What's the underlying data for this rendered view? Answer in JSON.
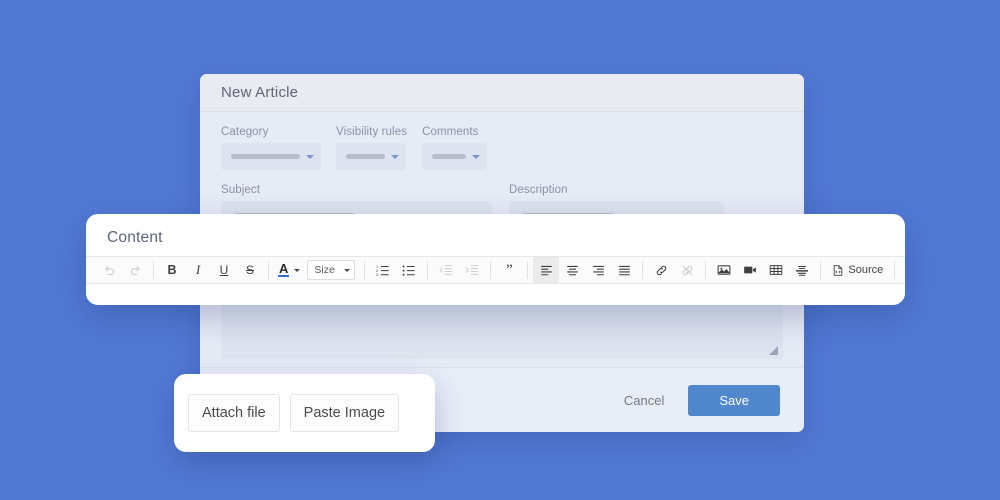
{
  "background_color": "#5179d4",
  "form": {
    "title": "New Article",
    "fields": {
      "category_label": "Category",
      "visibility_label": "Visibility rules",
      "comments_label": "Comments",
      "subject_label": "Subject",
      "description_label": "Description"
    },
    "footer": {
      "cancel_label": "Cancel",
      "save_label": "Save",
      "save_color": "#5087cd"
    }
  },
  "editor": {
    "title": "Content",
    "toolbar": {
      "size_label": "Size",
      "source_label": "Source",
      "color_letter": "A",
      "color_accent": "#2f6fc4",
      "items": [
        {
          "name": "undo-icon",
          "title": "Undo",
          "state": "disabled"
        },
        {
          "name": "redo-icon",
          "title": "Redo",
          "state": "disabled"
        },
        {
          "name": "bold-icon",
          "title": "Bold",
          "state": "normal"
        },
        {
          "name": "italic-icon",
          "title": "Italic",
          "state": "normal"
        },
        {
          "name": "underline-icon",
          "title": "Underline",
          "state": "normal"
        },
        {
          "name": "strikethrough-icon",
          "title": "Strikethrough",
          "state": "normal"
        },
        {
          "name": "text-color-icon",
          "title": "Text Color",
          "state": "normal"
        },
        {
          "name": "font-size-dropdown",
          "title": "Size",
          "state": "normal"
        },
        {
          "name": "numbered-list-icon",
          "title": "Insert/Remove Numbered List",
          "state": "normal"
        },
        {
          "name": "bulleted-list-icon",
          "title": "Insert/Remove Bulleted List",
          "state": "normal"
        },
        {
          "name": "outdent-icon",
          "title": "Decrease Indent",
          "state": "disabled"
        },
        {
          "name": "indent-icon",
          "title": "Increase Indent",
          "state": "disabled"
        },
        {
          "name": "blockquote-icon",
          "title": "Block Quote",
          "state": "normal"
        },
        {
          "name": "align-left-icon",
          "title": "Align Left",
          "state": "active"
        },
        {
          "name": "align-center-icon",
          "title": "Center",
          "state": "normal"
        },
        {
          "name": "align-right-icon",
          "title": "Align Right",
          "state": "normal"
        },
        {
          "name": "justify-icon",
          "title": "Justify",
          "state": "normal"
        },
        {
          "name": "link-icon",
          "title": "Link",
          "state": "normal"
        },
        {
          "name": "unlink-icon",
          "title": "Unlink",
          "state": "disabled"
        },
        {
          "name": "image-icon",
          "title": "Image",
          "state": "normal"
        },
        {
          "name": "video-icon",
          "title": "Video",
          "state": "normal"
        },
        {
          "name": "table-icon",
          "title": "Table",
          "state": "normal"
        },
        {
          "name": "horizontal-rule-icon",
          "title": "Horizontal Line",
          "state": "normal"
        },
        {
          "name": "source-button",
          "title": "Source",
          "state": "normal"
        },
        {
          "name": "maximize-icon",
          "title": "Maximize",
          "state": "normal"
        }
      ]
    }
  },
  "attach_popover": {
    "attach_file_label": "Attach file",
    "paste_image_label": "Paste Image"
  }
}
